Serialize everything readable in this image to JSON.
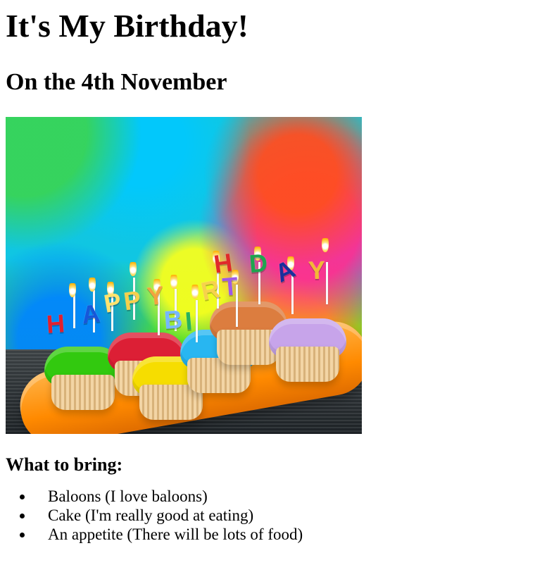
{
  "page": {
    "title": "It's My Birthday!",
    "subtitle": "On the 4th November"
  },
  "image": {
    "alt": "Birthday cupcakes with candles",
    "letters": [
      "H",
      "A",
      "P",
      "P",
      "Y",
      "B",
      "I",
      "R",
      "T",
      "H",
      "D",
      "A",
      "Y"
    ]
  },
  "section": {
    "title": "What to bring:"
  },
  "items": [
    "Baloons (I love baloons)",
    "Cake (I'm really good at eating)",
    "An appetite (There will be lots of food)"
  ]
}
